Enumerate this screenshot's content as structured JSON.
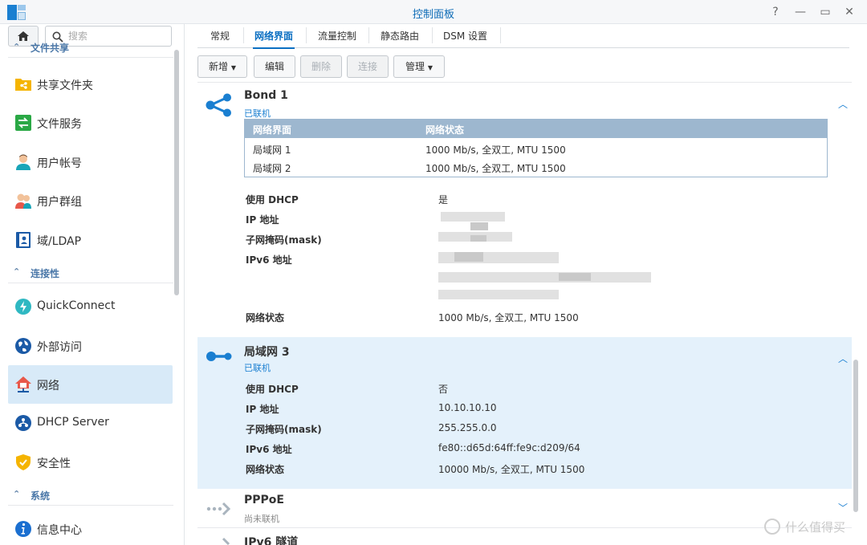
{
  "window": {
    "title": "控制面板",
    "help": "?",
    "minimize": "—",
    "maximize": "▭",
    "close": "✕"
  },
  "sidebar": {
    "search_placeholder": "搜索",
    "sections": [
      {
        "label": "文件共享"
      },
      {
        "label": "连接性"
      },
      {
        "label": "系统"
      }
    ],
    "items": [
      {
        "label": "共享文件夹",
        "icon": "shared-folder-icon"
      },
      {
        "label": "文件服务",
        "icon": "file-services-icon"
      },
      {
        "label": "用户帐号",
        "icon": "user-icon"
      },
      {
        "label": "用户群组",
        "icon": "group-icon"
      },
      {
        "label": "域/LDAP",
        "icon": "domain-ldap-icon"
      },
      {
        "label": "QuickConnect",
        "icon": "quickconnect-icon"
      },
      {
        "label": "外部访问",
        "icon": "external-access-icon"
      },
      {
        "label": "网络",
        "icon": "network-icon",
        "active": true
      },
      {
        "label": "DHCP Server",
        "icon": "dhcp-server-icon"
      },
      {
        "label": "安全性",
        "icon": "security-icon"
      },
      {
        "label": "信息中心",
        "icon": "info-center-icon"
      }
    ]
  },
  "tabs": [
    {
      "label": "常规"
    },
    {
      "label": "网络界面",
      "active": true
    },
    {
      "label": "流量控制"
    },
    {
      "label": "静态路由"
    },
    {
      "label": "DSM 设置"
    }
  ],
  "toolbar": {
    "create": "新增",
    "edit": "编辑",
    "delete": "删除",
    "connect": "连接",
    "manage": "管理"
  },
  "interfaces": {
    "bond1": {
      "title": "Bond 1",
      "status": "已联机",
      "table_headers": [
        "网络界面",
        "网络状态"
      ],
      "table_rows": [
        [
          "局域网 1",
          "1000 Mb/s, 全双工, MTU 1500"
        ],
        [
          "局域网 2",
          "1000 Mb/s, 全双工, MTU 1500"
        ]
      ],
      "dhcp_label": "使用 DHCP",
      "dhcp_value": "是",
      "ip_label": "IP 地址",
      "mask_label": "子网掩码(mask)",
      "ipv6_label": "IPv6 地址",
      "netstat_label": "网络状态",
      "netstat_value": "1000 Mb/s, 全双工, MTU 1500"
    },
    "lan3": {
      "title": "局域网 3",
      "status": "已联机",
      "dhcp_label": "使用 DHCP",
      "dhcp_value": "否",
      "ip_label": "IP 地址",
      "ip_value": "10.10.10.10",
      "mask_label": "子网掩码(mask)",
      "mask_value": "255.255.0.0",
      "ipv6_label": "IPv6 地址",
      "ipv6_value": "fe80::d65d:64ff:fe9c:d209/64",
      "netstat_label": "网络状态",
      "netstat_value": "10000 Mb/s, 全双工, MTU 1500"
    },
    "pppoe": {
      "title": "PPPoE",
      "status": "尚未联机"
    },
    "ipv6tunnel": {
      "title": "IPv6 隧道"
    }
  },
  "watermark": "什么值得买",
  "colors": {
    "accent": "#1a7fd1",
    "selected_bg": "#e4f1fb",
    "active_nav_bg": "#d8eaf8",
    "table_header": "#9db7cf"
  }
}
